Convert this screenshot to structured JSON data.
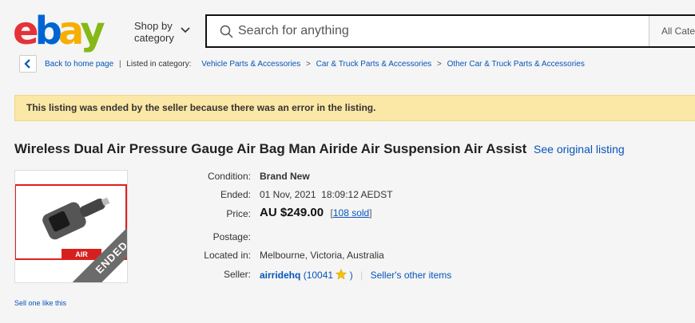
{
  "header": {
    "logo_letters": [
      {
        "ch": "e",
        "color": "#e53238"
      },
      {
        "ch": "b",
        "color": "#0064d2"
      },
      {
        "ch": "a",
        "color": "#f5af02"
      },
      {
        "ch": "y",
        "color": "#86b817"
      }
    ],
    "shop_by_line1": "Shop by",
    "shop_by_line2": "category",
    "search_placeholder": "Search for anything",
    "category_select": "All Cate"
  },
  "breadcrumb": {
    "back_label": "Back to home page",
    "listed_label": "Listed in category:",
    "items": [
      "Vehicle Parts & Accessories",
      "Car & Truck Parts & Accessories",
      "Other Car & Truck Parts & Accessories"
    ],
    "separator": ">"
  },
  "alert": {
    "message": "This listing was ended by the seller because there was an error in the listing."
  },
  "listing": {
    "title": "Wireless Dual Air Pressure Gauge Air Bag Man Airide Air Suspension Air Assist",
    "original_link": "See original listing",
    "ended_badge": "ENDED",
    "condition_label": "Condition:",
    "condition_value": "Brand New",
    "ended_label": "Ended:",
    "ended_value": "01 Nov, 2021  18:09:12 AEDST",
    "price_label": "Price:",
    "price_value": "AU $249.00",
    "sold_open": "[",
    "sold_link": "108 sold",
    "sold_close": "]",
    "postage_label": "Postage:",
    "postage_value": "",
    "location_label": "Located in:",
    "location_value": "Melbourne, Victoria, Australia",
    "seller_label": "Seller:",
    "seller_name": "airridehq",
    "seller_feedback_open": "(",
    "seller_feedback": "10041",
    "seller_feedback_close": ")",
    "seller_divider": "|",
    "seller_other": "Seller's other items"
  },
  "footer": {
    "sell_one": "Sell one like this"
  }
}
